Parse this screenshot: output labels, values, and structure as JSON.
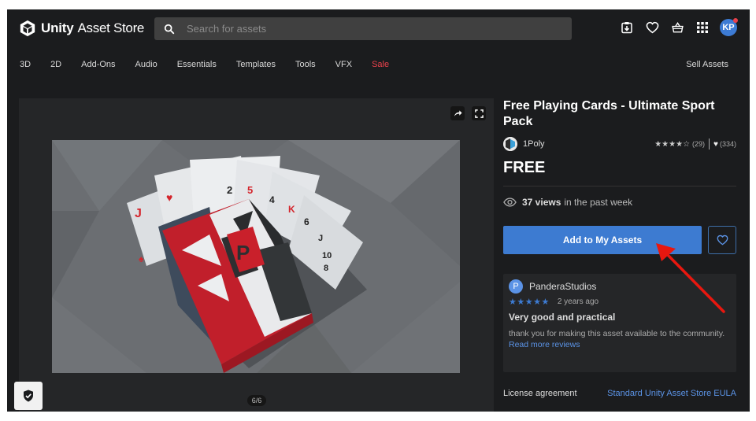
{
  "header": {
    "logo_bold": "Unity",
    "logo_light": "Asset Store",
    "search_placeholder": "Search for assets",
    "search_value": "",
    "icons": [
      "downloads-icon",
      "wishlist-heart-icon",
      "cart-basket-icon",
      "apps-grid-icon"
    ],
    "avatar_initials": "KP"
  },
  "nav": {
    "items": [
      "3D",
      "2D",
      "Add-Ons",
      "Audio",
      "Essentials",
      "Templates",
      "Tools",
      "VFX",
      "Sale"
    ],
    "sell_label": "Sell Assets",
    "accent_sale": "#e8414b"
  },
  "gallery": {
    "counter": "6/6",
    "current_image": 6,
    "total_images": 6,
    "image_description": "Low-poly deck of playing cards fanned out with red and black 'P' card box"
  },
  "product": {
    "title": "Free Playing Cards - Ultimate Sport Pack",
    "publisher": "1Poly",
    "rating_stars": 4,
    "rating_max": 5,
    "rating_count": "(29)",
    "favorites_count": "(334)",
    "price": "FREE",
    "views_count": "37 views",
    "views_suffix": "in the past week",
    "add_button": "Add to My Assets",
    "accent": "#3d7bd1"
  },
  "review": {
    "avatar_initial": "P",
    "author": "PanderaStudios",
    "stars": 5,
    "time": "2 years ago",
    "title": "Very good and practical",
    "body": "thank you for making this asset available to the community.",
    "more_link": "Read more reviews"
  },
  "license": {
    "label": "License agreement",
    "link": "Standard Unity Asset Store EULA"
  }
}
